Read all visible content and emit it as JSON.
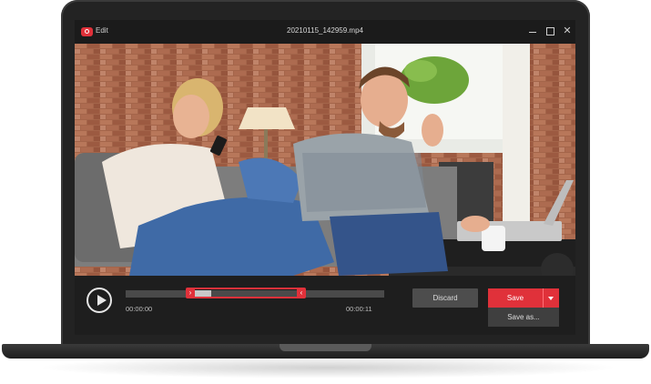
{
  "window": {
    "app_name": "Edit",
    "file_name": "20210115_142959.mp4",
    "controls": [
      "minimize-icon",
      "maximize-icon",
      "close-icon"
    ]
  },
  "player": {
    "progress_fraction": 0.33,
    "selection_start_fraction": 0.25,
    "selection_end_fraction": 0.69,
    "time_start": "00:00:00",
    "time_end": "00:00:11"
  },
  "actions": {
    "discard_label": "Discard",
    "save_label": "Save",
    "save_as_label": "Save as..."
  },
  "colors": {
    "accent": "#e0313a",
    "panel": "#1e1e1e",
    "button_gray": "#4d4d4d"
  }
}
